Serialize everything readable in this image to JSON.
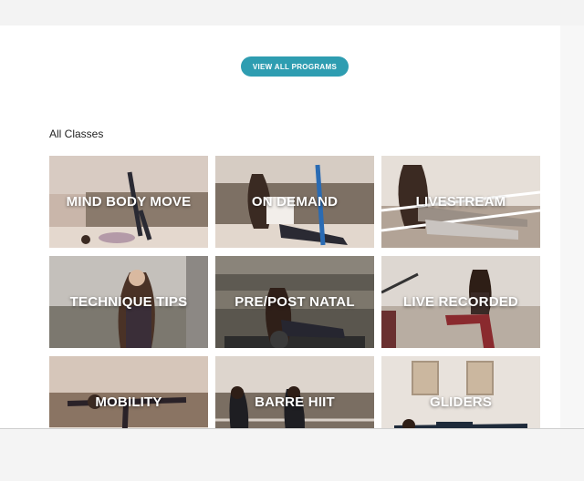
{
  "header": {
    "view_all_label": "VIEW ALL PROGRAMS"
  },
  "section": {
    "title": "All Classes"
  },
  "classes": [
    {
      "label": "MIND BODY MOVE"
    },
    {
      "label": "ON DEMAND"
    },
    {
      "label": "LIVESTREAM"
    },
    {
      "label": "TECHNIQUE TIPS"
    },
    {
      "label": "PRE/POST NATAL"
    },
    {
      "label": "LIVE RECORDED"
    },
    {
      "label": "MOBILITY"
    },
    {
      "label": "BARRE HIIT"
    },
    {
      "label": "GLIDERS"
    }
  ],
  "colors": {
    "accent": "#2e9db1"
  }
}
